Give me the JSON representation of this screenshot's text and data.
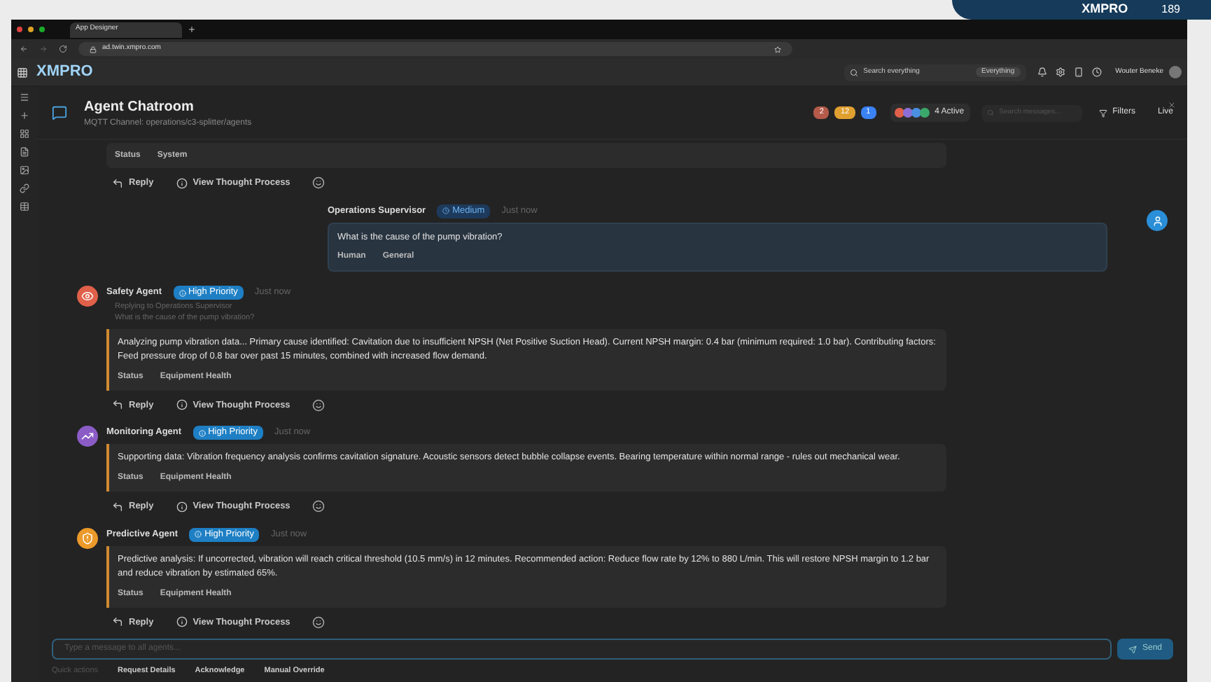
{
  "backdrop": {
    "brand": "XMPRO",
    "number": "189"
  },
  "browser": {
    "tab_title": "App Designer",
    "url": "ad.twin.xmpro.com"
  },
  "app_header": {
    "logo": "XMPRO",
    "search_placeholder": "Search everything",
    "scope": "Everything",
    "user_name": "Wouter Beneke"
  },
  "chat_header": {
    "title": "Agent Chatroom",
    "subtitle": "MQTT Channel: operations/c3-splitter/agents",
    "counters": [
      {
        "value": "2",
        "color": "#b45a4a"
      },
      {
        "value": "12",
        "color": "#e0a030"
      },
      {
        "value": "1",
        "color": "#3b82f6"
      }
    ],
    "agents": [
      {
        "color": "#e0604a"
      },
      {
        "color": "#8b6fd6"
      },
      {
        "color": "#4a8fe0"
      },
      {
        "color": "#3aa86a"
      }
    ],
    "active": "4 Active",
    "search_placeholder": "Search messages...",
    "filters": "Filters",
    "live": "Live"
  },
  "previous_message": {
    "tags": [
      "Status",
      "System"
    ],
    "actions": [
      "Reply",
      "View Thought Process"
    ]
  },
  "messages": [
    {
      "kind": "human",
      "author": "Operations Supervisor",
      "priority": "Medium",
      "time": "Just now",
      "body": "What is the cause of the pump vibration?",
      "tags": [
        "Human",
        "General"
      ]
    },
    {
      "kind": "agent",
      "author": "Safety Agent",
      "color": "#e0604a",
      "priority": "High Priority",
      "time": "Just now",
      "reply_to": "Replying to Operations Supervisor",
      "quote": "What is the cause of the pump vibration?",
      "body": "Analyzing pump vibration data... Primary cause identified: Cavitation due to insufficient NPSH (Net Positive Suction Head). Current NPSH margin: 0.4 bar (minimum required: 1.0 bar). Contributing factors: Feed pressure drop of 0.8 bar over past 15 minutes, combined with increased flow demand.",
      "tags": [
        "Status",
        "Equipment Health"
      ],
      "actions": [
        "Reply",
        "View Thought Process"
      ]
    },
    {
      "kind": "agent",
      "author": "Monitoring Agent",
      "color": "#8b5cc6",
      "priority": "High Priority",
      "time": "Just now",
      "body": "Supporting data: Vibration frequency analysis confirms cavitation signature. Acoustic sensors detect bubble collapse events. Bearing temperature within normal range - rules out mechanical wear.",
      "tags": [
        "Status",
        "Equipment Health"
      ],
      "actions": [
        "Reply",
        "View Thought Process"
      ]
    },
    {
      "kind": "agent",
      "author": "Predictive Agent",
      "color": "#eb9a2a",
      "priority": "High Priority",
      "time": "Just now",
      "body": "Predictive analysis: If uncorrected, vibration will reach critical threshold (10.5 mm/s) in 12 minutes. Recommended action: Reduce flow rate by 12% to 880 L/min. This will restore NPSH margin to 1.2 bar and reduce vibration by estimated 65%.",
      "tags": [
        "Status",
        "Equipment Health"
      ],
      "actions": [
        "Reply",
        "View Thought Process"
      ]
    }
  ],
  "composer": {
    "placeholder": "Type a message to all agents...",
    "send": "Send"
  },
  "quick_actions": {
    "label": "Quick actions",
    "items": [
      "Request Details",
      "Acknowledge",
      "Manual Override"
    ]
  }
}
